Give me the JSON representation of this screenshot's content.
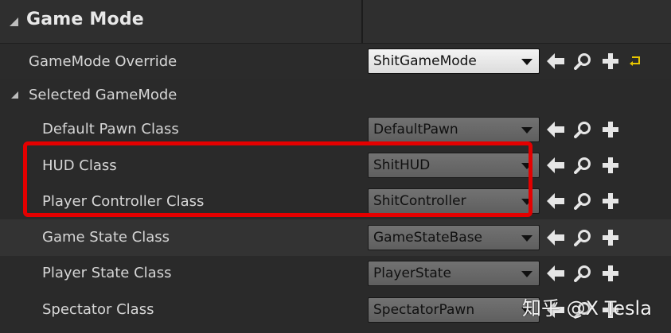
{
  "category": {
    "title": "Game Mode"
  },
  "rows": [
    {
      "label": "GameMode Override",
      "value": "ShitGameMode",
      "enabled": true,
      "has_reset": true
    },
    {
      "label": "Selected GameMode",
      "is_group": true
    },
    {
      "label": "Default Pawn Class",
      "value": "DefaultPawn",
      "enabled": false
    },
    {
      "label": "HUD Class",
      "value": "ShitHUD",
      "enabled": false
    },
    {
      "label": "Player Controller Class",
      "value": "ShitController",
      "enabled": false
    },
    {
      "label": "Game State Class",
      "value": "GameStateBase",
      "enabled": false
    },
    {
      "label": "Player State Class",
      "value": "PlayerState",
      "enabled": false
    },
    {
      "label": "Spectator Class",
      "value": "SpectatorPawn",
      "enabled": false
    }
  ],
  "icons": {
    "use": "arrow-left-icon",
    "browse": "magnifier-icon",
    "create": "plus-icon",
    "reset": "reset-to-default-icon"
  },
  "colors": {
    "highlight": "#e40000",
    "reset": "#e8c600",
    "icon": "#e6e6e6"
  },
  "watermark": "知乎 @X Tesla"
}
